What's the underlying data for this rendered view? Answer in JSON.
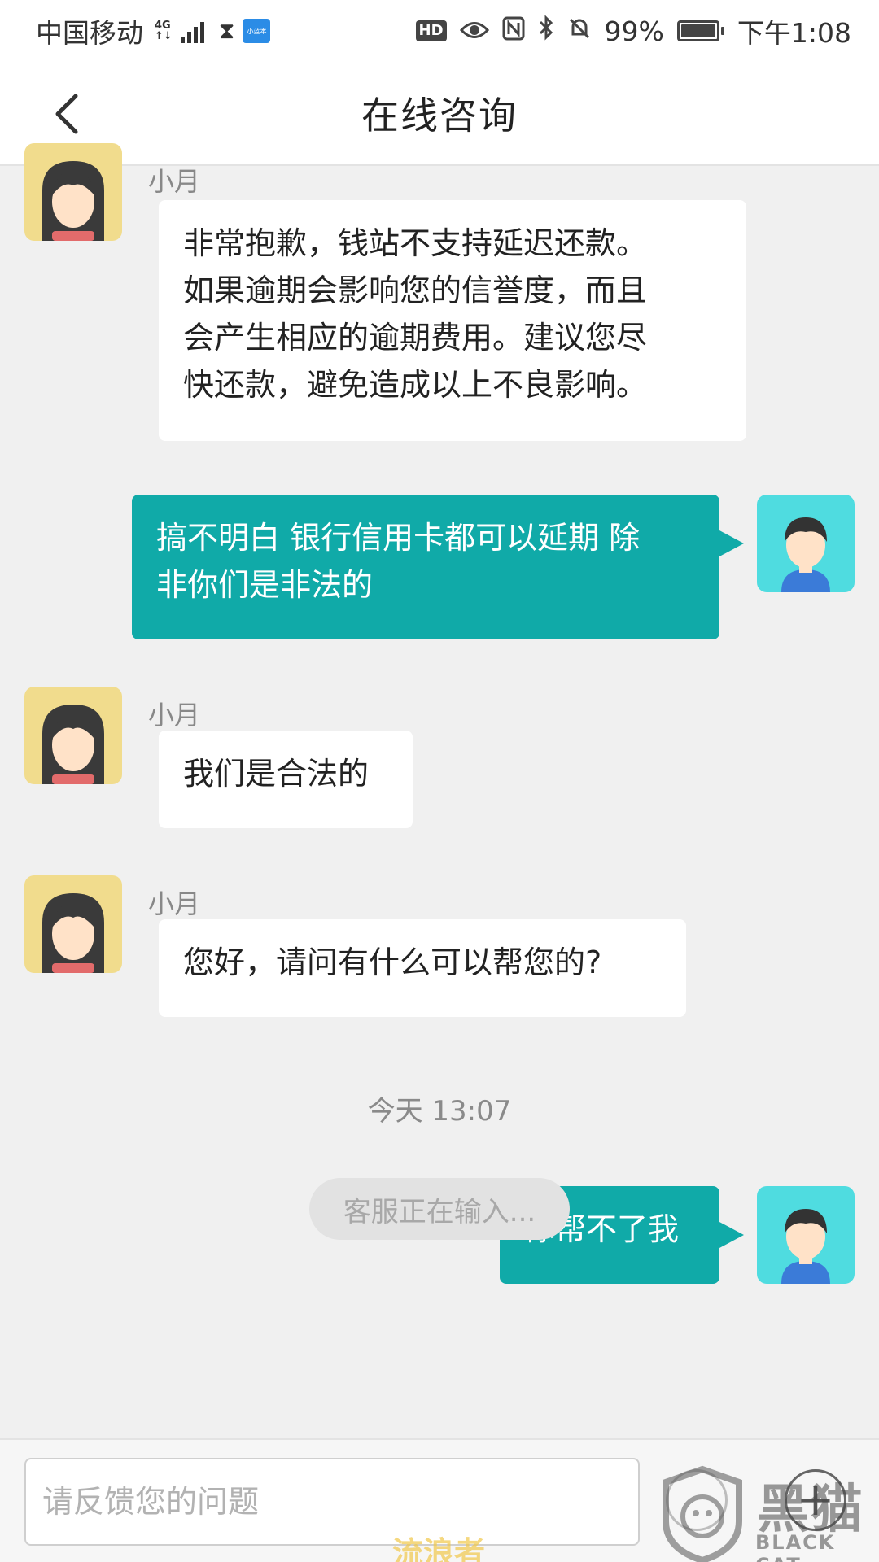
{
  "status_bar": {
    "carrier": "中国移动",
    "network": "4G",
    "battery": "99%",
    "time": "下午1:08",
    "hd_badge": "HD",
    "app_icon": "小蓝本"
  },
  "header": {
    "title": "在线咨询"
  },
  "messages": [
    {
      "side": "in",
      "sender": "小月",
      "text_lines": [
        "非常抱歉，钱站不支持延迟还款。",
        "如果逾期会影响您的信誉度，而且",
        "会产生相应的逾期费用。建议您尽",
        "快还款，避免造成以上不良影响。"
      ]
    },
    {
      "side": "out",
      "text_lines": [
        "搞不明白 银行信用卡都可以延期 除",
        "非你们是非法的"
      ]
    },
    {
      "side": "in",
      "sender": "小月",
      "text_lines": [
        "我们是合法的"
      ]
    },
    {
      "side": "in",
      "sender": "小月",
      "text_lines": [
        "您好，请问有什么可以帮您的?"
      ]
    },
    {
      "side": "out",
      "text_lines": [
        "你帮不了我"
      ]
    }
  ],
  "timestamp": "今天 13:07",
  "typing_indicator": "客服正在输入...",
  "input": {
    "placeholder": "请反馈您的问题"
  },
  "watermark": {
    "brand": "黑猫",
    "sub": "BLACK CAT",
    "overlay": "流浪者"
  },
  "colors": {
    "outgoing_bubble": "#10aaa8",
    "incoming_bubble": "#ffffff",
    "agent_avatar_bg": "#f1dc8d",
    "user_avatar_bg": "#4fdce0"
  }
}
